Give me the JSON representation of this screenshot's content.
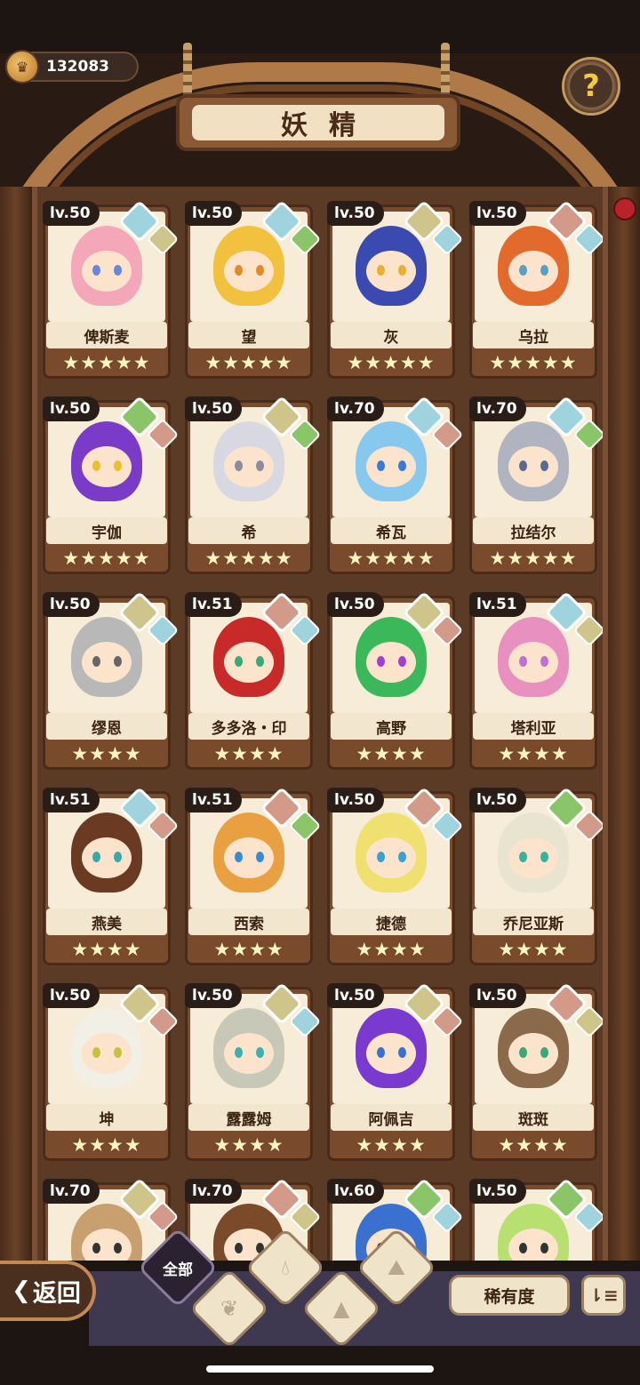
{
  "header": {
    "currency_value": "132083",
    "title": "妖精",
    "help_label": "?"
  },
  "cards": [
    {
      "level": "lv.50",
      "name": "俾斯麦",
      "stars": "★★★★★",
      "hair": "#f3a7b8",
      "eyes": "#6a86d8",
      "elem1": "#9fd4df",
      "elem2": "#cfc48a"
    },
    {
      "level": "lv.50",
      "name": "望",
      "stars": "★★★★★",
      "hair": "#f2c23e",
      "eyes": "#e08a2a",
      "elem1": "#9fd4df",
      "elem2": "#8bc56a"
    },
    {
      "level": "lv.50",
      "name": "灰",
      "stars": "★★★★★",
      "hair": "#3a4ab0",
      "eyes": "#e8b030",
      "elem1": "#cfc48a",
      "elem2": "#9fd4df"
    },
    {
      "level": "lv.50",
      "name": "乌拉",
      "stars": "★★★★★",
      "hair": "#e26a2c",
      "eyes": "#5aa0c0",
      "elem1": "#d39a8a",
      "elem2": "#9fd4df"
    },
    {
      "level": "lv.50",
      "name": "宇伽",
      "stars": "★★★★★",
      "hair": "#7a3cc8",
      "eyes": "#e8c030",
      "elem1": "#8bc56a",
      "elem2": "#d39a8a"
    },
    {
      "level": "lv.50",
      "name": "希",
      "stars": "★★★★★",
      "hair": "#d8d8e2",
      "eyes": "#8a8aa0",
      "elem1": "#cfc48a",
      "elem2": "#8bc56a"
    },
    {
      "level": "lv.70",
      "name": "希瓦",
      "stars": "★★★★★",
      "hair": "#86c8ee",
      "eyes": "#3a7ad8",
      "elem1": "#9fd4df",
      "elem2": "#d39a8a"
    },
    {
      "level": "lv.70",
      "name": "拉结尔",
      "stars": "★★★★★",
      "hair": "#b0b4c0",
      "eyes": "#5a6a90",
      "elem1": "#9fd4df",
      "elem2": "#8bc56a"
    },
    {
      "level": "lv.50",
      "name": "缪恩",
      "stars": "★★★★",
      "hair": "#b8b8b8",
      "eyes": "#666666",
      "elem1": "#cfc48a",
      "elem2": "#9fd4df"
    },
    {
      "level": "lv.51",
      "name": "多多洛・印",
      "stars": "★★★★",
      "hair": "#c82a2a",
      "eyes": "#3aa878",
      "elem1": "#d39a8a",
      "elem2": "#9fd4df"
    },
    {
      "level": "lv.50",
      "name": "高野",
      "stars": "★★★★",
      "hair": "#3ab85a",
      "eyes": "#a040d0",
      "elem1": "#cfc48a",
      "elem2": "#d39a8a"
    },
    {
      "level": "lv.51",
      "name": "塔利亚",
      "stars": "★★★★",
      "hair": "#e890c0",
      "eyes": "#c070d0",
      "elem1": "#9fd4df",
      "elem2": "#cfc48a"
    },
    {
      "level": "lv.51",
      "name": "燕美",
      "stars": "★★★★",
      "hair": "#6a3a22",
      "eyes": "#3aa8a8",
      "elem1": "#9fd4df",
      "elem2": "#d39a8a"
    },
    {
      "level": "lv.51",
      "name": "西索",
      "stars": "★★★★",
      "hair": "#e8a040",
      "eyes": "#3a8ad0",
      "elem1": "#d39a8a",
      "elem2": "#8bc56a"
    },
    {
      "level": "lv.50",
      "name": "捷德",
      "stars": "★★★★",
      "hair": "#f0e070",
      "eyes": "#3aa0d0",
      "elem1": "#d39a8a",
      "elem2": "#9fd4df"
    },
    {
      "level": "lv.50",
      "name": "乔尼亚斯",
      "stars": "★★★★",
      "hair": "#e8e4d0",
      "eyes": "#3ab0a0",
      "elem1": "#8bc56a",
      "elem2": "#d39a8a"
    },
    {
      "level": "lv.50",
      "name": "坤",
      "stars": "★★★★",
      "hair": "#f2efe6",
      "eyes": "#c8c040",
      "elem1": "#cfc48a",
      "elem2": "#d39a8a"
    },
    {
      "level": "lv.50",
      "name": "露露姆",
      "stars": "★★★★",
      "hair": "#c8c8b8",
      "eyes": "#3ab0b0",
      "elem1": "#cfc48a",
      "elem2": "#9fd4df"
    },
    {
      "level": "lv.50",
      "name": "阿佩吉",
      "stars": "★★★★",
      "hair": "#7a3ad0",
      "eyes": "#3a70d0",
      "elem1": "#cfc48a",
      "elem2": "#d39a8a"
    },
    {
      "level": "lv.50",
      "name": "斑斑",
      "stars": "★★★★",
      "hair": "#8a6a4a",
      "eyes": "#3aa878",
      "elem1": "#d39a8a",
      "elem2": "#cfc48a"
    },
    {
      "level": "lv.70",
      "name": "",
      "stars": "",
      "hair": "#c8a070",
      "eyes": "#333333",
      "elem1": "#cfc48a",
      "elem2": "#d39a8a"
    },
    {
      "level": "lv.70",
      "name": "",
      "stars": "",
      "hair": "#7a4a2a",
      "eyes": "#333333",
      "elem1": "#d39a8a",
      "elem2": "#cfc48a"
    },
    {
      "level": "lv.60",
      "name": "",
      "stars": "",
      "hair": "#3a70d0",
      "eyes": "#333333",
      "elem1": "#8bc56a",
      "elem2": "#9fd4df"
    },
    {
      "level": "lv.50",
      "name": "",
      "stars": "",
      "hair": "#b8e070",
      "eyes": "#333333",
      "elem1": "#8bc56a",
      "elem2": "#9fd4df"
    }
  ],
  "footer": {
    "back_label": "返回",
    "filter_all": "全部",
    "rarity_label": "稀有度",
    "sort_icon": "sort-icon"
  },
  "colors": {
    "wood_dark": "#5b3a26",
    "wood_light": "#b07a48",
    "card_bg": "#f6ecd8",
    "tray": "#3e3850"
  }
}
